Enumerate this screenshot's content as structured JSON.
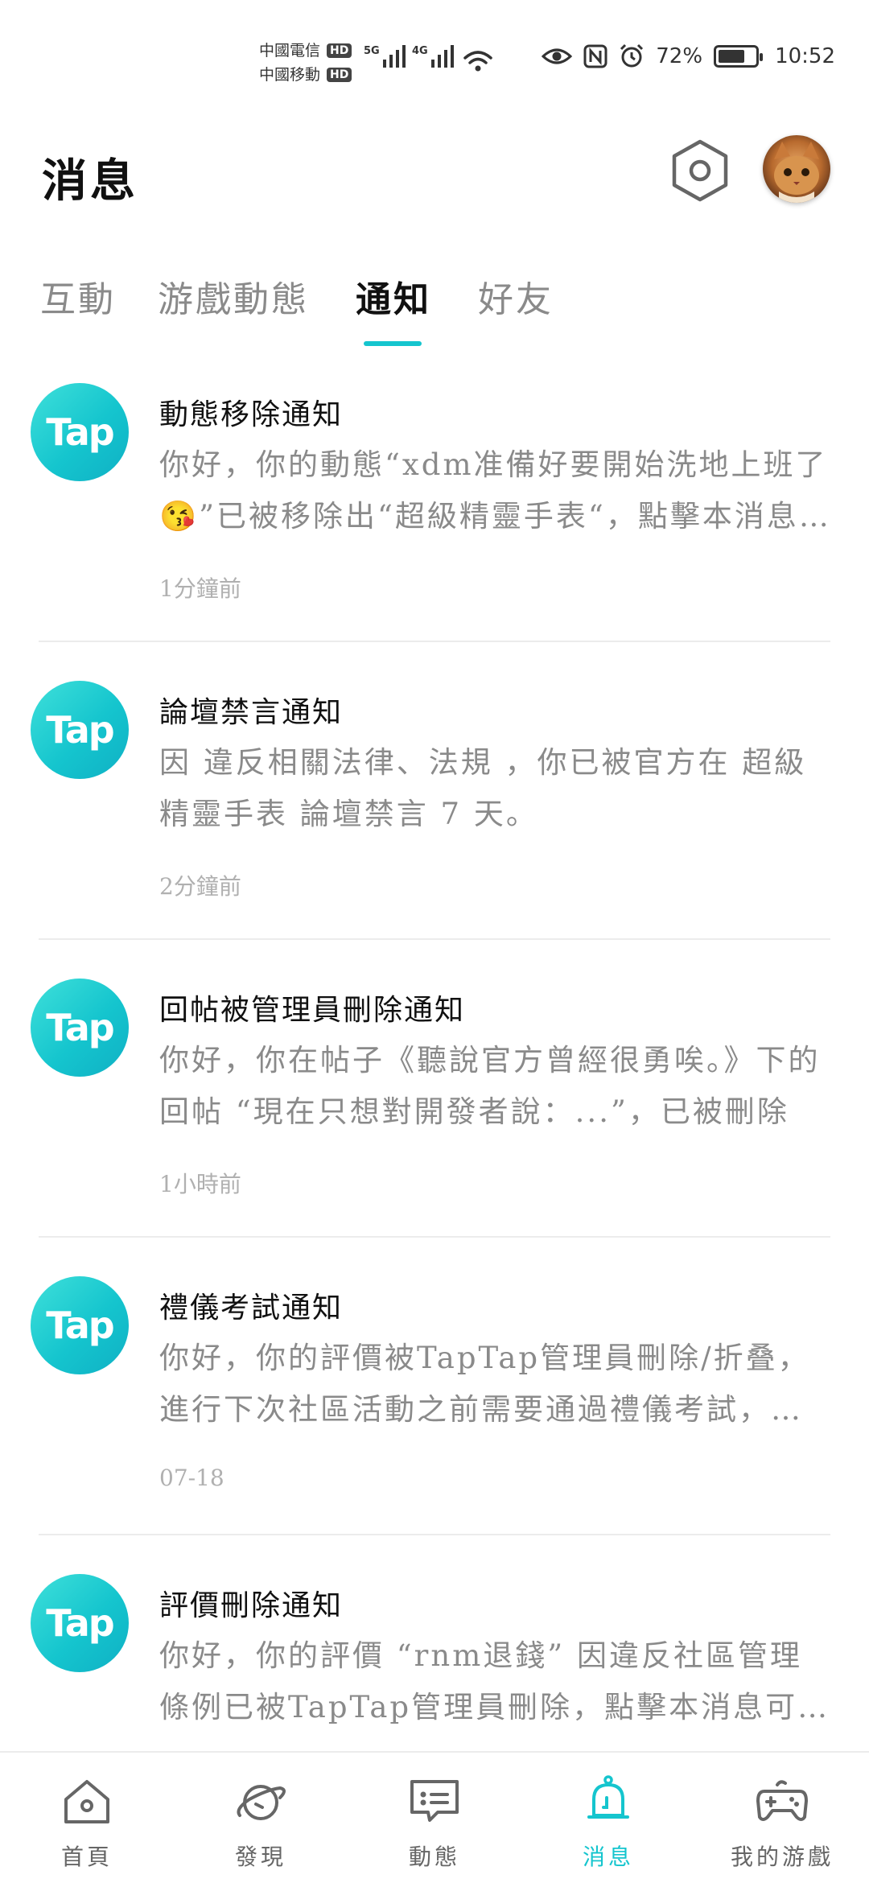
{
  "status_bar": {
    "carrier_1": "中國電信",
    "carrier_2": "中國移動",
    "hd": "HD",
    "net_1": "5G",
    "net_2": "4G",
    "battery": "72%",
    "time": "10:52"
  },
  "header": {
    "title": "消息"
  },
  "tabs": [
    {
      "label": "互動"
    },
    {
      "label": "游戲動態"
    },
    {
      "label": "通知"
    },
    {
      "label": "好友"
    }
  ],
  "active_tab": "通知",
  "notifications": [
    {
      "icon": "tap-logo",
      "logo_text": "Tap",
      "title": "動態移除通知",
      "body": "你好，你的動態“xdm准備好要開始洗地上班了😘”已被移除出“超級精靈手表“，點擊本消息可查看詳情",
      "time": "1分鐘前"
    },
    {
      "icon": "tap-logo",
      "logo_text": "Tap",
      "title": "論壇禁言通知",
      "body": "因 違反相關法律、法規 ，你已被官方在 超級精靈手表 論壇禁言 7 天。",
      "time": "2分鐘前"
    },
    {
      "icon": "tap-logo",
      "logo_text": "Tap",
      "title": "回帖被管理員刪除通知",
      "body": "你好，你在帖子《聽說官方曾經很勇唉。》下的回帖 “現在只想對開發者說：...”，已被刪除",
      "time": "1小時前"
    },
    {
      "icon": "tap-logo",
      "logo_text": "Tap",
      "title": "禮儀考試通知",
      "body": "你好，你的評價被TapTap管理員刪除/折叠，進行下次社區活動之前需要通過禮儀考試，點擊參加",
      "time": "07-18"
    },
    {
      "icon": "tap-logo",
      "logo_text": "Tap",
      "title": "評價刪除通知",
      "body": "你好，你的評價 “rnm退錢” 因違反社區管理條例已被TapTap管理員刪除，點擊本消息可查看詳情",
      "time": ""
    }
  ],
  "bottom_nav": [
    {
      "label": "首頁",
      "icon": "home-icon"
    },
    {
      "label": "發現",
      "icon": "planet-icon"
    },
    {
      "label": "動態",
      "icon": "chat-card-icon"
    },
    {
      "label": "消息",
      "icon": "bell-icon"
    },
    {
      "label": "我的游戲",
      "icon": "gamepad-icon"
    }
  ],
  "colors": {
    "accent": "#15c5ce",
    "muted_text": "#8a8a8a",
    "time_text": "#b0b0b0",
    "divider": "#ececec"
  }
}
